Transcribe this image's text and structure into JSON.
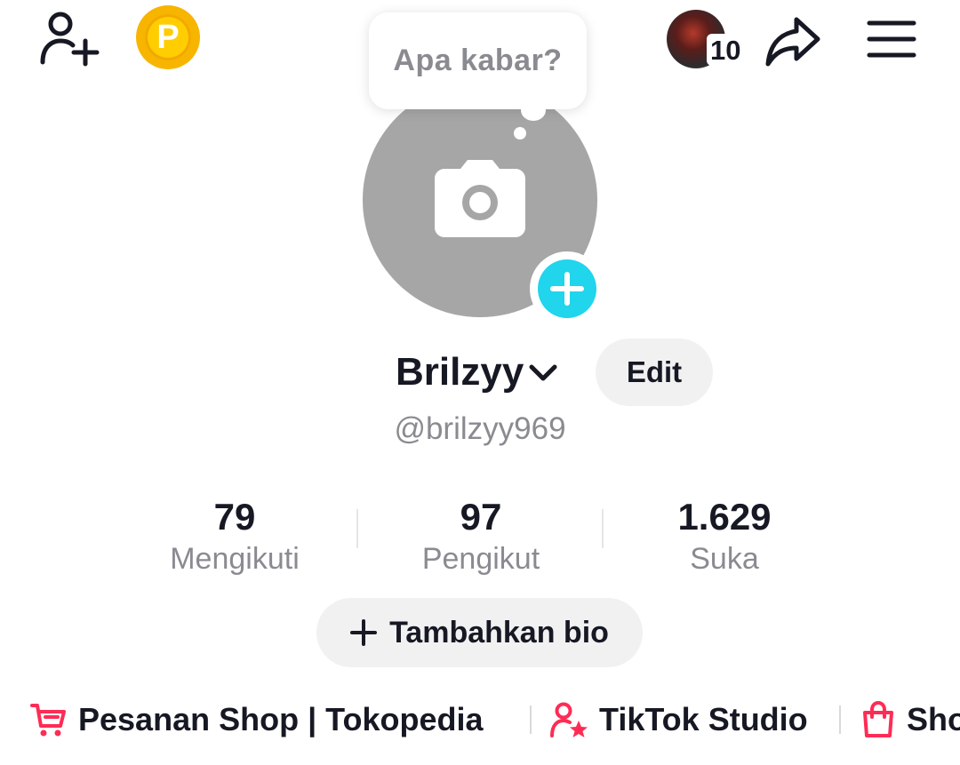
{
  "topbar": {
    "add_friend_icon": "person-plus-icon",
    "coin_icon": "points-coin-icon",
    "coin_letter": "P",
    "story_count": "10",
    "share_icon": "share-arrow-icon",
    "menu_icon": "hamburger-menu-icon"
  },
  "bubble": {
    "text": "Apa kabar?"
  },
  "profile": {
    "display_name": "Brilzyy",
    "username": "@brilzyy969",
    "edit_label": "Edit"
  },
  "stats": [
    {
      "value": "79",
      "label": "Mengikuti"
    },
    {
      "value": "97",
      "label": "Pengikut"
    },
    {
      "value": "1.629",
      "label": "Suka"
    }
  ],
  "bio_button": {
    "label": "Tambahkan bio"
  },
  "shortcuts": [
    {
      "label": "Pesanan Shop | Tokopedia",
      "icon": "cart-icon"
    },
    {
      "label": "TikTok Studio",
      "icon": "person-star-icon"
    },
    {
      "label": "Sho",
      "icon": "shopping-bag-icon"
    }
  ],
  "colors": {
    "accent": "#20d5ec",
    "pink": "#fe2c55",
    "coin": "#ffcd00",
    "avatar_placeholder": "#a6a6a6",
    "muted_text": "#8a8b91"
  }
}
